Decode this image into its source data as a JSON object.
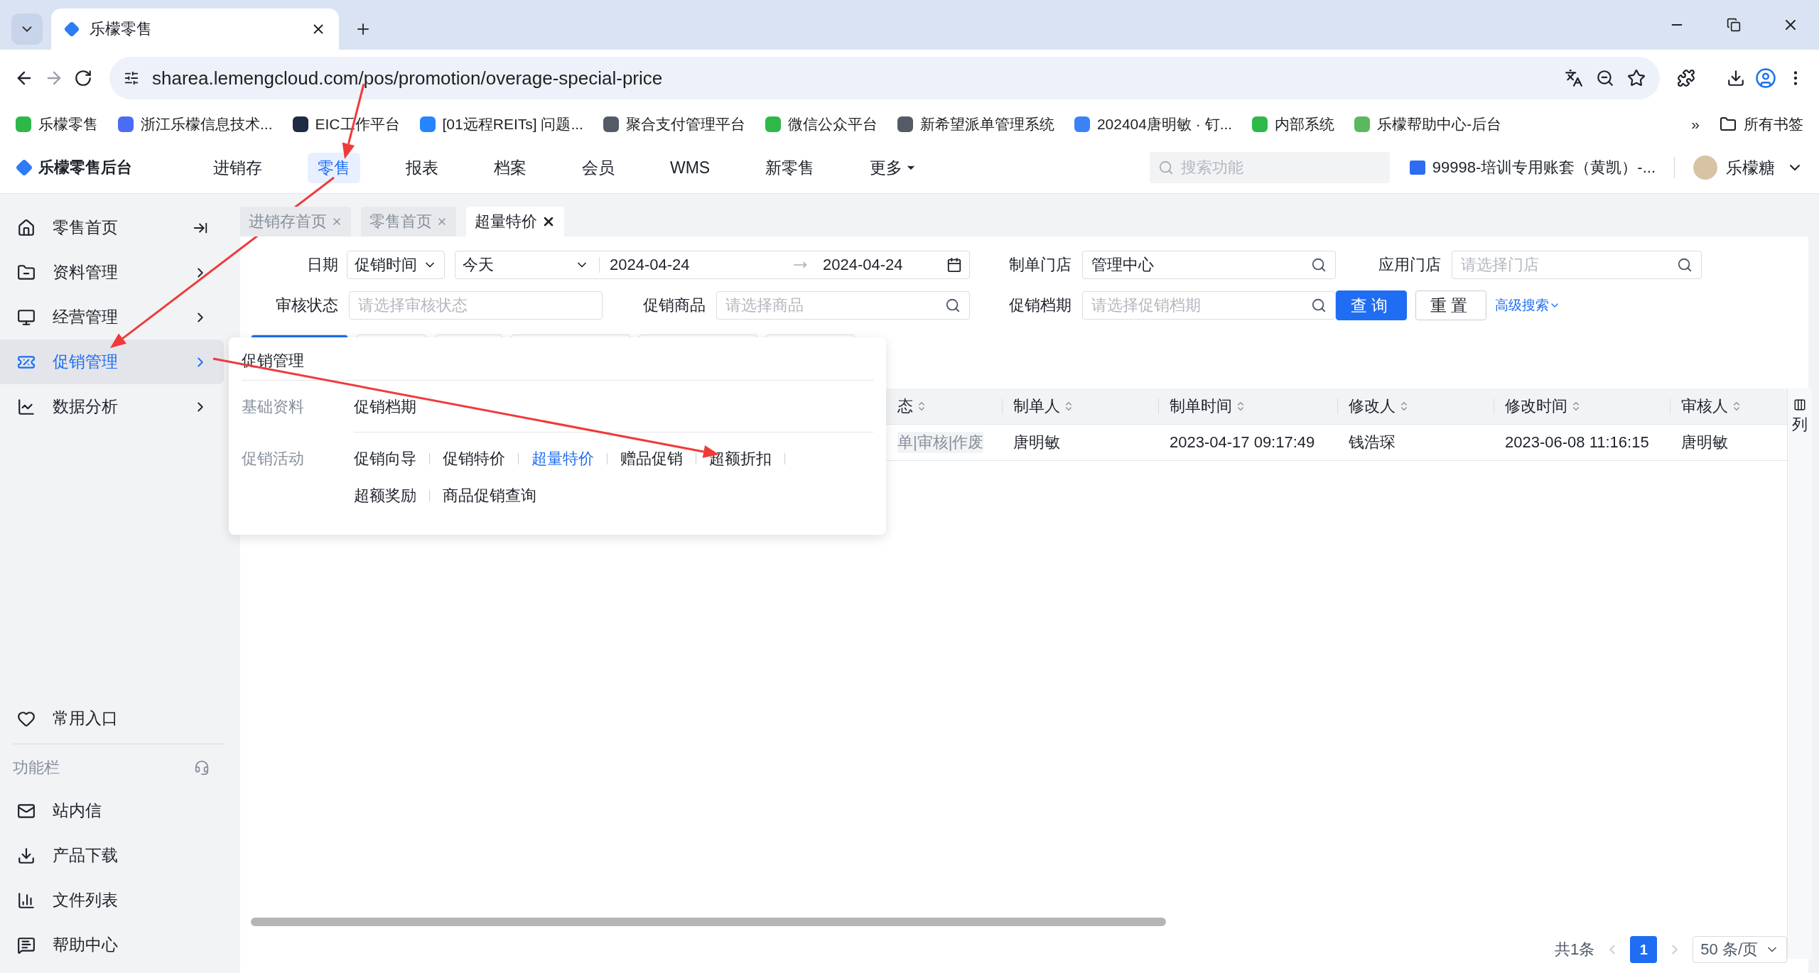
{
  "browser": {
    "tabs": [
      {
        "title": "乐檬零售",
        "selected": true
      }
    ],
    "url": "sharea.lemengcloud.com/pos/promotion/overage-special-price",
    "bookmarks": [
      {
        "label": "乐檬零售",
        "color": "#2fb84a"
      },
      {
        "label": "浙江乐檬信息技术...",
        "color": "#4a6cf7"
      },
      {
        "label": "EIC工作平台",
        "color": "#1f2a44"
      },
      {
        "label": "[01远程REITs] 问题...",
        "color": "#2684ff"
      },
      {
        "label": "聚合支付管理平台",
        "color": "#555b66"
      },
      {
        "label": "微信公众平台",
        "color": "#2fb84a"
      },
      {
        "label": "新希望派单管理系统",
        "color": "#555b66"
      },
      {
        "label": "202404唐明敏 · 钉...",
        "color": "#3b82f6"
      },
      {
        "label": "内部系统",
        "color": "#2fb84a"
      },
      {
        "label": "乐檬帮助中心-后台",
        "color": "#5cb85c"
      }
    ],
    "bookmarks_more": "»",
    "all_bookmarks": "所有书签"
  },
  "app_header": {
    "brand": "乐檬零售后台",
    "nav": [
      {
        "label": "进销存",
        "selected": false,
        "has_menu": false
      },
      {
        "label": "零售",
        "selected": true,
        "has_menu": false
      },
      {
        "label": "报表",
        "selected": false,
        "has_menu": false
      },
      {
        "label": "档案",
        "selected": false,
        "has_menu": false
      },
      {
        "label": "会员",
        "selected": false,
        "has_menu": false
      },
      {
        "label": "WMS",
        "selected": false,
        "has_menu": false
      },
      {
        "label": "新零售",
        "selected": false,
        "has_menu": false
      },
      {
        "label": "更多",
        "selected": false,
        "has_menu": true
      }
    ],
    "search": {
      "placeholder": "搜索功能"
    },
    "account": "99998-培训专用账套（黄凯）-...",
    "user": "乐檬糖"
  },
  "sidebar": {
    "items": [
      {
        "label": "零售首页",
        "selected": false,
        "kind": "link"
      },
      {
        "label": "资料管理",
        "selected": false,
        "kind": "group"
      },
      {
        "label": "经营管理",
        "selected": false,
        "kind": "group"
      },
      {
        "label": "促销管理",
        "selected": true,
        "kind": "group"
      },
      {
        "label": "数据分析",
        "selected": false,
        "kind": "group"
      }
    ],
    "favorites": "常用入口",
    "toolbar_title": "功能栏",
    "tools": [
      {
        "label": "站内信"
      },
      {
        "label": "产品下载"
      },
      {
        "label": "文件列表"
      },
      {
        "label": "帮助中心"
      }
    ]
  },
  "page_tabs": [
    {
      "label": "进销存首页",
      "selected": false
    },
    {
      "label": "零售首页",
      "selected": false
    },
    {
      "label": "超量特价",
      "selected": true
    }
  ],
  "filters": {
    "date": {
      "label": "日期",
      "type": "促销时间",
      "preset": "今天",
      "start": "2024-04-24",
      "end": "2024-04-24"
    },
    "fields": [
      {
        "label": "制单门店",
        "value": "管理中心",
        "kind": "search"
      },
      {
        "label": "应用门店",
        "placeholder": "请选择门店",
        "kind": "search"
      },
      {
        "label": "审核状态",
        "placeholder": "请选择审核状态",
        "kind": "select"
      },
      {
        "label": "促销商品",
        "placeholder": "请选择商品",
        "kind": "search"
      },
      {
        "label": "促销档期",
        "placeholder": "请选择促销档期",
        "kind": "search"
      }
    ],
    "query": "查询",
    "reset": "重置",
    "advanced": "高级搜索"
  },
  "popup": {
    "title": "促销管理",
    "groups": [
      {
        "label": "基础资料",
        "links": [
          {
            "label": "促销档期",
            "selected": false
          }
        ]
      },
      {
        "label": "促销活动",
        "links": [
          {
            "label": "促销向导",
            "selected": false
          },
          {
            "label": "促销特价",
            "selected": false
          },
          {
            "label": "超量特价",
            "selected": true
          },
          {
            "label": "赠品促销",
            "selected": false
          },
          {
            "label": "超额折扣",
            "selected": false
          },
          {
            "label": "超额奖励",
            "selected": false
          },
          {
            "label": "商品促销查询",
            "selected": false
          }
        ]
      }
    ]
  },
  "table": {
    "columns": [
      {
        "label": "态"
      },
      {
        "label": "制单人"
      },
      {
        "label": "制单时间"
      },
      {
        "label": "修改人"
      },
      {
        "label": "修改时间"
      },
      {
        "label": "审核人"
      }
    ],
    "rows": [
      {
        "cells": [
          "单|审核|作废",
          "唐明敏",
          "2023-04-17 09:17:49",
          "钱浩琛",
          "2023-06-08 11:16:15",
          "唐明敏"
        ]
      }
    ],
    "column_settings": "列"
  },
  "pagination": {
    "total": "共1条",
    "pages": [
      {
        "label": "1",
        "selected": true
      }
    ],
    "page_size": "50 条/页"
  }
}
